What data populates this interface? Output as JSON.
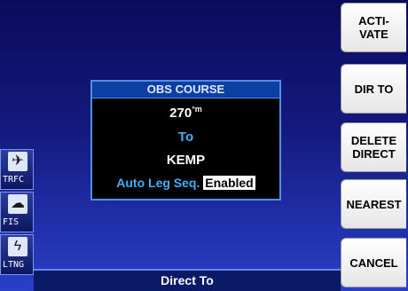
{
  "softkeys": [
    {
      "label": "ACTI-\nVATE"
    },
    {
      "label": "DIR TO"
    },
    {
      "label": "DELETE\nDIRECT"
    },
    {
      "label": "NEAREST"
    },
    {
      "label": "CANCEL"
    }
  ],
  "dialog": {
    "title": "OBS COURSE",
    "course_value": "270",
    "course_unit": "°m",
    "to_from": "To",
    "waypoint": "KEMP",
    "auto_leg_label": "Auto Leg Seq.",
    "auto_leg_value": "Enabled"
  },
  "left_buttons": [
    {
      "label": "TRFC",
      "icon": "traffic-icon"
    },
    {
      "label": "FIS",
      "icon": "weather-icon"
    },
    {
      "label": "LTNG",
      "icon": "lightning-icon"
    }
  ],
  "status": {
    "text": "Direct To"
  },
  "colors": {
    "accent_blue": "#3fb0ff",
    "dialog_border": "#4f8fe8"
  }
}
